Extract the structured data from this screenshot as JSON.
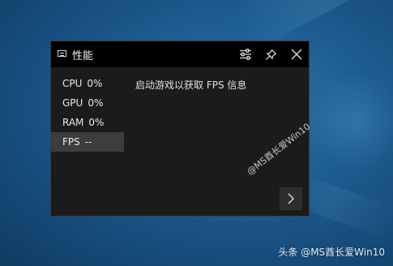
{
  "panel": {
    "title": "性能",
    "stats": [
      {
        "label": "CPU",
        "value": "0%"
      },
      {
        "label": "GPU",
        "value": "0%"
      },
      {
        "label": "RAM",
        "value": "0%"
      },
      {
        "label": "FPS",
        "value": "--"
      }
    ],
    "selected_stat": "FPS",
    "fps_message": "启动游戏以获取 FPS 信息",
    "watermark": "@MS酋长爱Win10"
  },
  "desktop": {
    "attribution": "头条 @MS酋长爱Win10"
  },
  "icons": {
    "title": "performance-monitor-icon",
    "settings": "sliders-icon",
    "pin": "pin-icon",
    "close": "close-icon",
    "expand": "chevron-right-icon"
  },
  "colors": {
    "panel_bg": "#1b1b1b",
    "titlebar_bg": "#000000",
    "selected_row_bg": "#3d3d3d",
    "desktop_bg": "#1f5e93"
  }
}
